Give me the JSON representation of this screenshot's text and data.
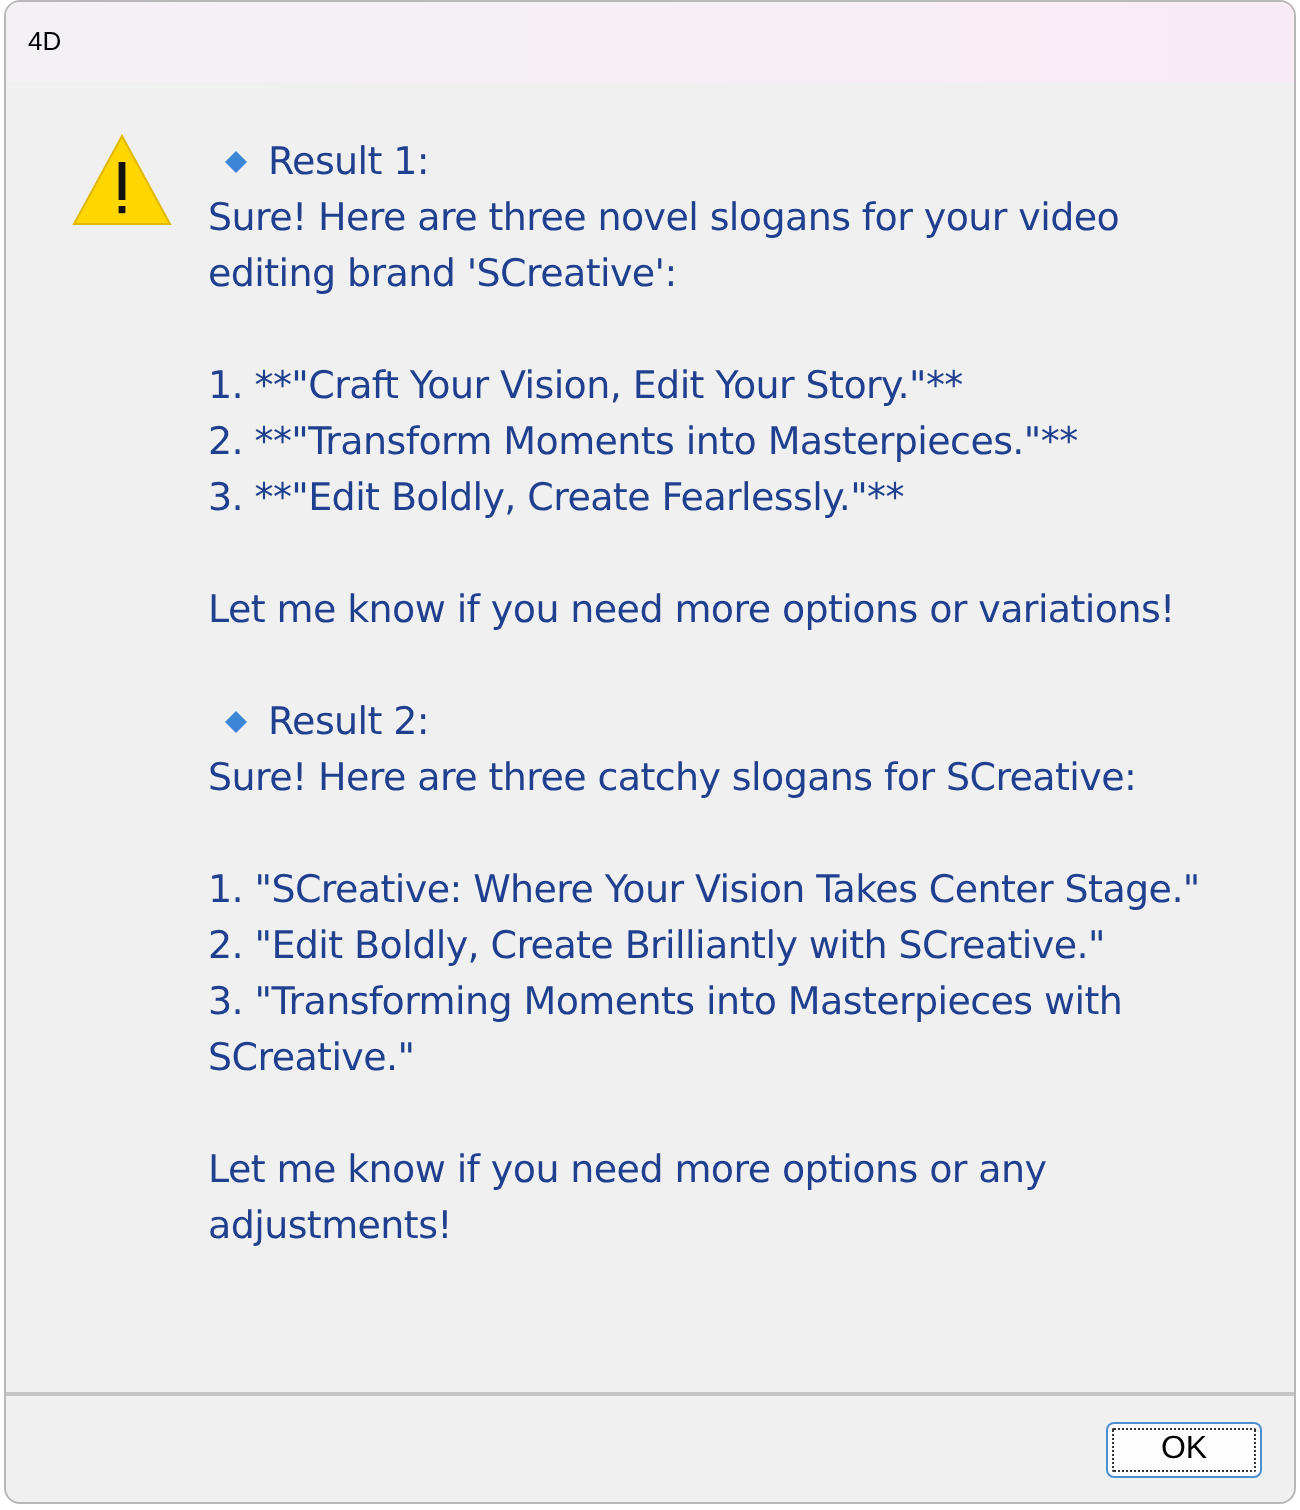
{
  "window": {
    "title": "4D"
  },
  "message": {
    "results": [
      {
        "heading": "Result 1:",
        "intro": "Sure! Here are three novel slogans for your video editing brand 'SCreative':",
        "items": [
          "1. **\"Craft Your Vision, Edit Your Story.\"**",
          "2. **\"Transform Moments into Masterpieces.\"**",
          "3. **\"Edit Boldly, Create Fearlessly.\"**"
        ],
        "closing": "Let me know if you need more options or variations!"
      },
      {
        "heading": "Result 2:",
        "intro": "Sure! Here are three catchy slogans for SCreative:",
        "items": [
          "1. \"SCreative: Where Your Vision Takes Center Stage.\"",
          "2. \"Edit Boldly, Create Brilliantly with SCreative.\"",
          "3. \"Transforming Moments into Masterpieces with SCreative.\""
        ],
        "closing": "Let me know if you need more options or any adjustments!"
      }
    ]
  },
  "buttons": [
    {
      "label": "OK"
    }
  ]
}
